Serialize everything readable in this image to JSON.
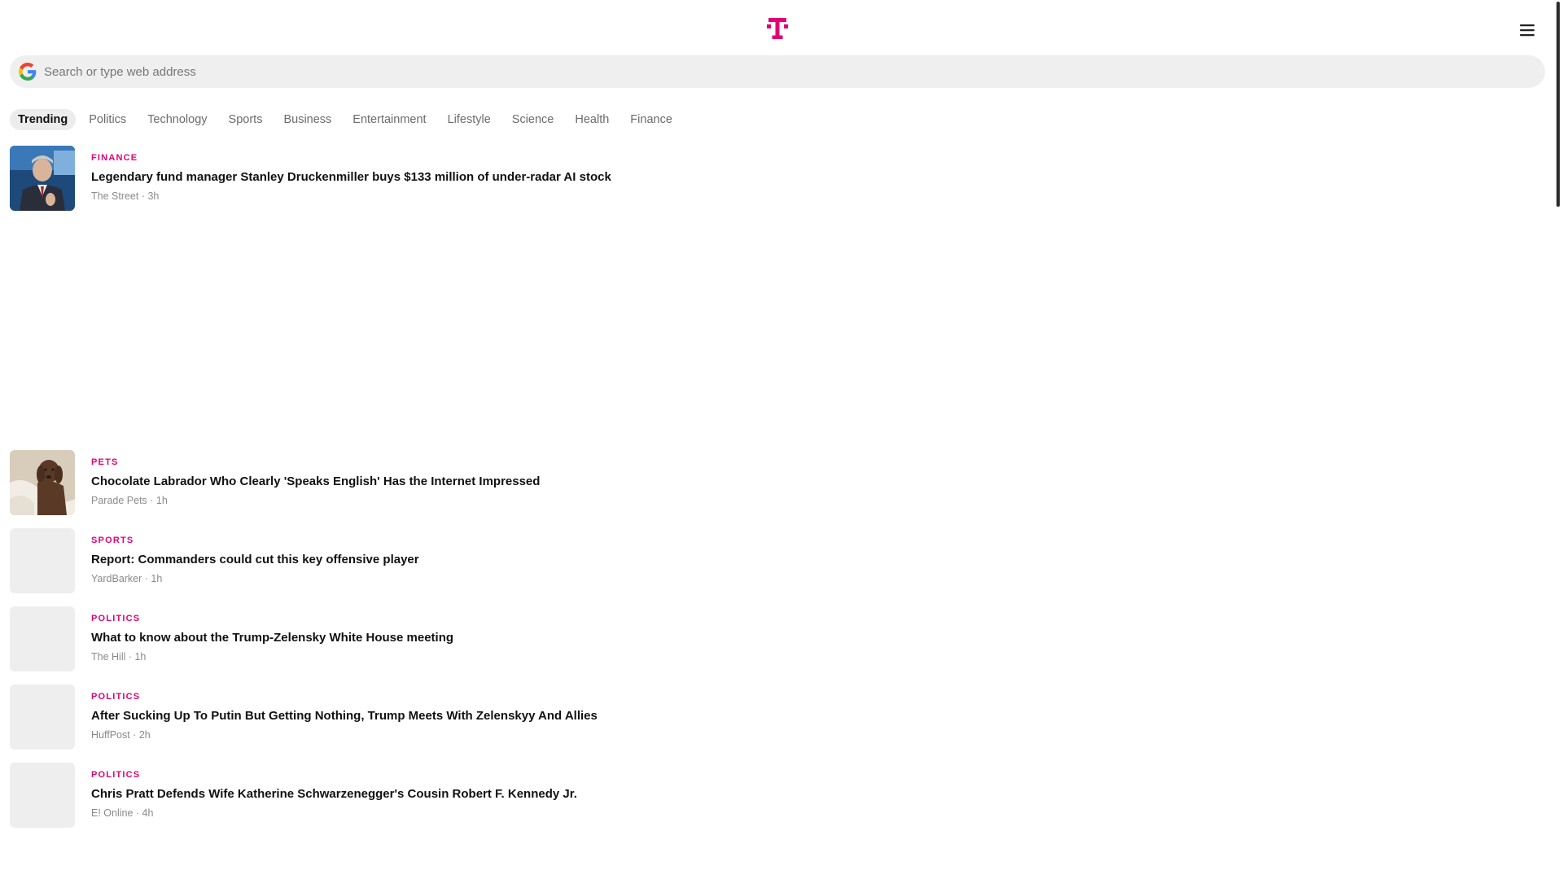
{
  "header": {
    "logo_icon": "t-mobile-logo-icon",
    "menu_icon": "hamburger-menu-icon",
    "brand_color": "#e20074"
  },
  "search": {
    "placeholder": "Search or type web address",
    "value": "",
    "icon": "google-g-icon"
  },
  "tabs": [
    {
      "label": "Trending",
      "active": true
    },
    {
      "label": "Politics",
      "active": false
    },
    {
      "label": "Technology",
      "active": false
    },
    {
      "label": "Sports",
      "active": false
    },
    {
      "label": "Business",
      "active": false
    },
    {
      "label": "Entertainment",
      "active": false
    },
    {
      "label": "Lifestyle",
      "active": false
    },
    {
      "label": "Science",
      "active": false
    },
    {
      "label": "Health",
      "active": false
    },
    {
      "label": "Finance",
      "active": false
    }
  ],
  "articles": [
    {
      "category": "FINANCE",
      "headline": "Legendary fund manager Stanley Druckenmiller buys $133 million of under-radar AI stock",
      "meta": "The Street · 3h",
      "thumbnail": "portrait-photo"
    },
    {
      "category": "PETS",
      "headline": "Chocolate Labrador Who Clearly 'Speaks English' Has the Internet Impressed",
      "meta": "Parade Pets · 1h",
      "thumbnail": "dog-photo"
    },
    {
      "category": "SPORTS",
      "headline": "Report: Commanders could cut this key offensive player",
      "meta": "YardBarker · 1h",
      "thumbnail": "placeholder"
    },
    {
      "category": "POLITICS",
      "headline": "What to know about the Trump-Zelensky White House meeting",
      "meta": "The Hill · 1h",
      "thumbnail": "placeholder"
    },
    {
      "category": "POLITICS",
      "headline": "After Sucking Up To Putin But Getting Nothing, Trump Meets With Zelenskyy And Allies",
      "meta": "HuffPost · 2h",
      "thumbnail": "placeholder"
    },
    {
      "category": "POLITICS",
      "headline": "Chris Pratt Defends Wife Katherine Schwarzenegger's Cousin Robert F. Kennedy Jr.",
      "meta": "E! Online · 4h",
      "thumbnail": "placeholder"
    }
  ]
}
